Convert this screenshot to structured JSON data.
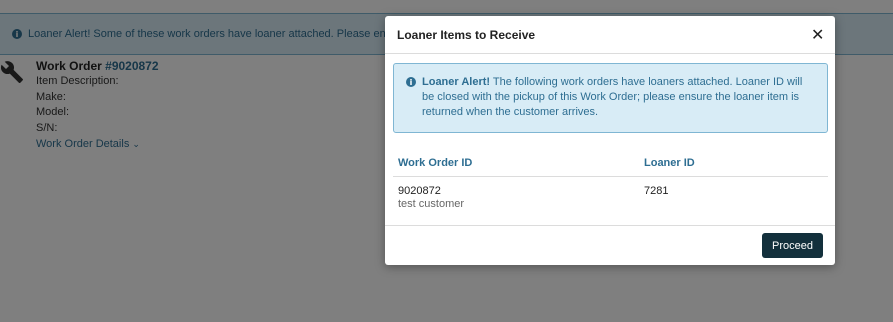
{
  "background": {
    "alert_icon": "info-circle-icon",
    "alert_text": "Loaner Alert! Some of these work orders have loaner attached. Please ensure the loaner item is returned when the customer arrives.",
    "work_order": {
      "icon": "wrench-icon",
      "title_prefix": "Work Order ",
      "number": "#9020872",
      "item_description_label": "Item Description:",
      "make_label": "Make:",
      "model_label": "Model:",
      "sn_label": "S/N:",
      "details_link": "Work Order Details",
      "details_chevron": "chevron-down-icon"
    }
  },
  "modal": {
    "title": "Loaner Items to Receive",
    "close_icon": "close-icon",
    "alert": {
      "icon": "info-circle-icon",
      "heading": "Loaner Alert!",
      "text": " The following work orders have loaners attached. Loaner ID will be closed with the pickup of this Work Order; please ensure the loaner item is returned when the customer arrives."
    },
    "table": {
      "headers": [
        "Work Order ID",
        "Loaner ID"
      ],
      "rows": [
        {
          "work_order_id": "9020872",
          "customer": "test customer",
          "loaner_id": "7281"
        }
      ]
    },
    "proceed_label": "Proceed"
  },
  "colors": {
    "accent": "#2e6e92",
    "alert_bg": "#d8ecf6",
    "button_bg": "#13303c",
    "overlay": "rgba(0,0,0,0.5)"
  }
}
